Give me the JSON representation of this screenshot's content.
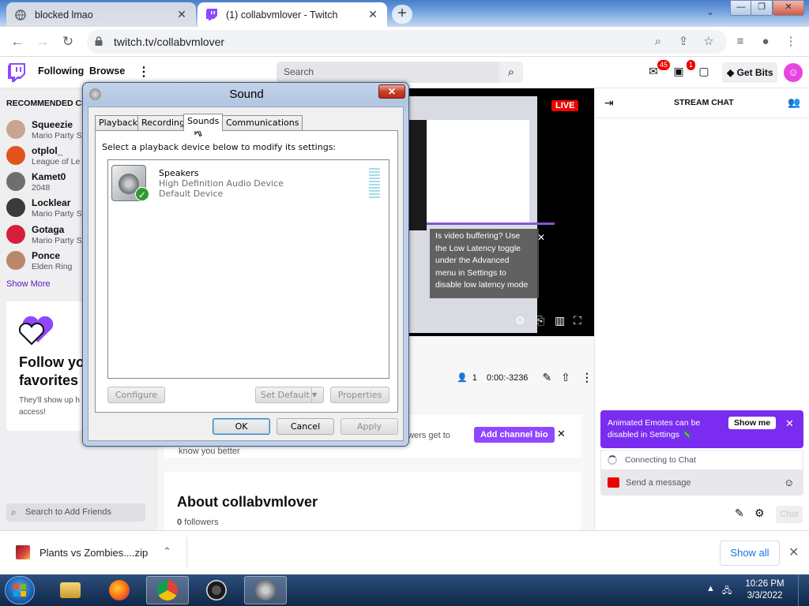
{
  "browser": {
    "tabs": [
      {
        "title": "blocked lmao",
        "active": false
      },
      {
        "title": "(1) collabvmlover - Twitch",
        "active": true
      }
    ],
    "url": "twitch.tv/collabvmlover"
  },
  "twitch": {
    "nav": {
      "following": "Following",
      "browse": "Browse",
      "search_placeholder": "Search",
      "inbox_count": "45",
      "notif_count": "1",
      "get_bits": "Get Bits"
    },
    "sidebar": {
      "header": "RECOMMENDED CHA",
      "channels": [
        {
          "name": "Squeezie",
          "game": "Mario Party S",
          "color": "#c9a58f"
        },
        {
          "name": "otplol_",
          "game": "League of Le",
          "color": "#e0541b"
        },
        {
          "name": "Kamet0",
          "game": "2048",
          "color": "#6e6e6e"
        },
        {
          "name": "Locklear",
          "game": "Mario Party S",
          "color": "#3a3a3a"
        },
        {
          "name": "Gotaga",
          "game": "Mario Party S",
          "color": "#d6203b"
        },
        {
          "name": "Ponce",
          "game": "Elden Ring",
          "color": "#b9876b"
        }
      ],
      "show_more": "Show More",
      "follow_heading_1": "Follow yo",
      "follow_heading_2": "favorites",
      "follow_sub_1": "They'll show up h",
      "follow_sub_2": "access!",
      "add_friends_placeholder": "Search to Add Friends"
    },
    "player": {
      "live": "LIVE",
      "tooltip_lines": [
        "Is video buffering? Use",
        "the Low Latency toggle",
        "under the Advanced",
        "menu in Settings to",
        "disable low latency mode"
      ]
    },
    "stream_info": {
      "viewers": "1",
      "uptime": "0:00:-3236"
    },
    "bio": {
      "text": "owers get to",
      "text2": "know you better",
      "button": "Add channel bio"
    },
    "about": {
      "title": "About collabvmlover",
      "followers_count": "0",
      "followers_label": "followers"
    },
    "chat": {
      "title": "STREAM CHAT",
      "emotes_line1": "Animated Emotes can be",
      "emotes_line2": "disabled in Settings",
      "show_me": "Show me",
      "connecting": "Connecting to Chat",
      "send_placeholder": "Send a message",
      "chat_button": "Chat"
    }
  },
  "downloads": {
    "file": "Plants vs Zombies....zip",
    "show_all": "Show all"
  },
  "taskbar": {
    "time": "10:26 PM",
    "date": "3/3/2022"
  },
  "sound_dialog": {
    "title": "Sound",
    "tabs": [
      "Playback",
      "Recording",
      "Sounds",
      "Communications"
    ],
    "selected_tab": "Sounds",
    "instruction": "Select a playback device below to modify its settings:",
    "device": {
      "name": "Speakers",
      "description": "High Definition Audio Device",
      "status": "Default Device"
    },
    "configure": "Configure",
    "set_default": "Set Default",
    "properties": "Properties",
    "ok": "OK",
    "cancel": "Cancel",
    "apply": "Apply"
  }
}
